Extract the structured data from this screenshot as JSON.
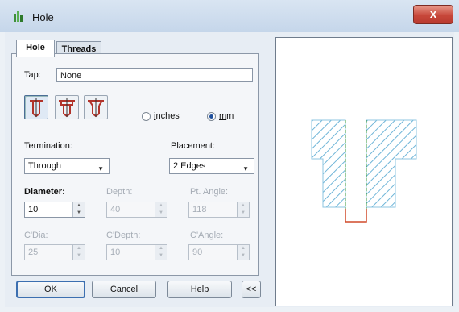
{
  "window": {
    "title": "Hole",
    "close_label": "x"
  },
  "tabs": [
    {
      "label": "Hole",
      "active": true
    },
    {
      "label": "Threads",
      "active": false
    }
  ],
  "tap": {
    "label": "Tap:",
    "value": "None"
  },
  "hole_types": {
    "icons": [
      "simple-hole-icon",
      "counterbore-hole-icon",
      "countersink-hole-icon"
    ],
    "selected_index": 0
  },
  "units": {
    "options": [
      "inches",
      "mm"
    ],
    "selected": "mm"
  },
  "termination": {
    "label": "Termination:",
    "value": "Through"
  },
  "placement": {
    "label": "Placement:",
    "value": "2 Edges"
  },
  "fields": {
    "diameter": {
      "label": "Diameter:",
      "value": "10",
      "enabled": true
    },
    "depth": {
      "label": "Depth:",
      "value": "40",
      "enabled": false
    },
    "pt_angle": {
      "label": "Pt. Angle:",
      "value": "118",
      "enabled": false
    },
    "c_dia": {
      "label": "C'Dia:",
      "value": "25",
      "enabled": false
    },
    "c_depth": {
      "label": "C'Depth:",
      "value": "10",
      "enabled": false
    },
    "c_angle": {
      "label": "C'Angle:",
      "value": "90",
      "enabled": false
    }
  },
  "buttons": {
    "ok": "OK",
    "cancel": "Cancel",
    "help": "Help",
    "collapse": "<<"
  },
  "colors": {
    "hatch": "#6fb5d8",
    "centerline": "#3a9a3a",
    "drill_tip": "#d14a2a",
    "accent": "#3c6fb0"
  }
}
